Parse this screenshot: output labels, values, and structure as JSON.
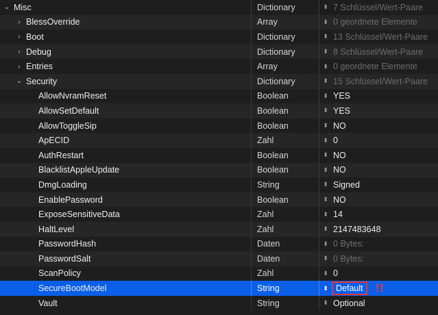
{
  "rows": [
    {
      "key": "Misc",
      "level": 0,
      "disclosure": "⌄",
      "type": "Dictionary",
      "value": "7 Schlüssel/Wert-Paare",
      "value_style": "dim"
    },
    {
      "key": "BlessOverride",
      "level": 1,
      "disclosure": "›",
      "type": "Array",
      "value": "0 geordnete Elemente",
      "value_style": "dim"
    },
    {
      "key": "Boot",
      "level": 1,
      "disclosure": "›",
      "type": "Dictionary",
      "value": "13 Schlüssel/Wert-Paare",
      "value_style": "dim"
    },
    {
      "key": "Debug",
      "level": 1,
      "disclosure": "›",
      "type": "Dictionary",
      "value": "8 Schlüssel/Wert-Paare",
      "value_style": "dim"
    },
    {
      "key": "Entries",
      "level": 1,
      "disclosure": "›",
      "type": "Array",
      "value": "0 geordnete Elemente",
      "value_style": "dim"
    },
    {
      "key": "Security",
      "level": 1,
      "disclosure": "⌄",
      "type": "Dictionary",
      "value": "15 Schlüssel/Wert-Paare",
      "value_style": "dim"
    },
    {
      "key": "AllowNvramReset",
      "level": 2,
      "disclosure": "",
      "type": "Boolean",
      "value": "YES",
      "value_style": "text"
    },
    {
      "key": "AllowSetDefault",
      "level": 2,
      "disclosure": "",
      "type": "Boolean",
      "value": "YES",
      "value_style": "text"
    },
    {
      "key": "AllowToggleSip",
      "level": 2,
      "disclosure": "",
      "type": "Boolean",
      "value": "NO",
      "value_style": "text"
    },
    {
      "key": "ApECID",
      "level": 2,
      "disclosure": "",
      "type": "Zahl",
      "value": "0",
      "value_style": "text"
    },
    {
      "key": "AuthRestart",
      "level": 2,
      "disclosure": "",
      "type": "Boolean",
      "value": "NO",
      "value_style": "text"
    },
    {
      "key": "BlacklistAppleUpdate",
      "level": 2,
      "disclosure": "",
      "type": "Boolean",
      "value": "NO",
      "value_style": "text"
    },
    {
      "key": "DmgLoading",
      "level": 2,
      "disclosure": "",
      "type": "String",
      "value": "Signed",
      "value_style": "text"
    },
    {
      "key": "EnablePassword",
      "level": 2,
      "disclosure": "",
      "type": "Boolean",
      "value": "NO",
      "value_style": "text"
    },
    {
      "key": "ExposeSensitiveData",
      "level": 2,
      "disclosure": "",
      "type": "Zahl",
      "value": "14",
      "value_style": "text"
    },
    {
      "key": "HaltLevel",
      "level": 2,
      "disclosure": "",
      "type": "Zahl",
      "value": "2147483648",
      "value_style": "text"
    },
    {
      "key": "PasswordHash",
      "level": 2,
      "disclosure": "",
      "type": "Daten",
      "value": "0 Bytes:",
      "value_style": "dim"
    },
    {
      "key": "PasswordSalt",
      "level": 2,
      "disclosure": "",
      "type": "Daten",
      "value": "0 Bytes:",
      "value_style": "dim"
    },
    {
      "key": "ScanPolicy",
      "level": 2,
      "disclosure": "",
      "type": "Zahl",
      "value": "0",
      "value_style": "text"
    },
    {
      "key": "SecureBootModel",
      "level": 2,
      "disclosure": "",
      "type": "String",
      "value": "Default",
      "value_style": "boxed",
      "selected": true,
      "annotation": "!!"
    },
    {
      "key": "Vault",
      "level": 2,
      "disclosure": "",
      "type": "String",
      "value": "Optional",
      "value_style": "text"
    }
  ],
  "stepper_glyph": "⬍",
  "colors": {
    "selection": "#0a5fe8",
    "annotation_red": "#e53535",
    "background": "#1e1e1e"
  }
}
